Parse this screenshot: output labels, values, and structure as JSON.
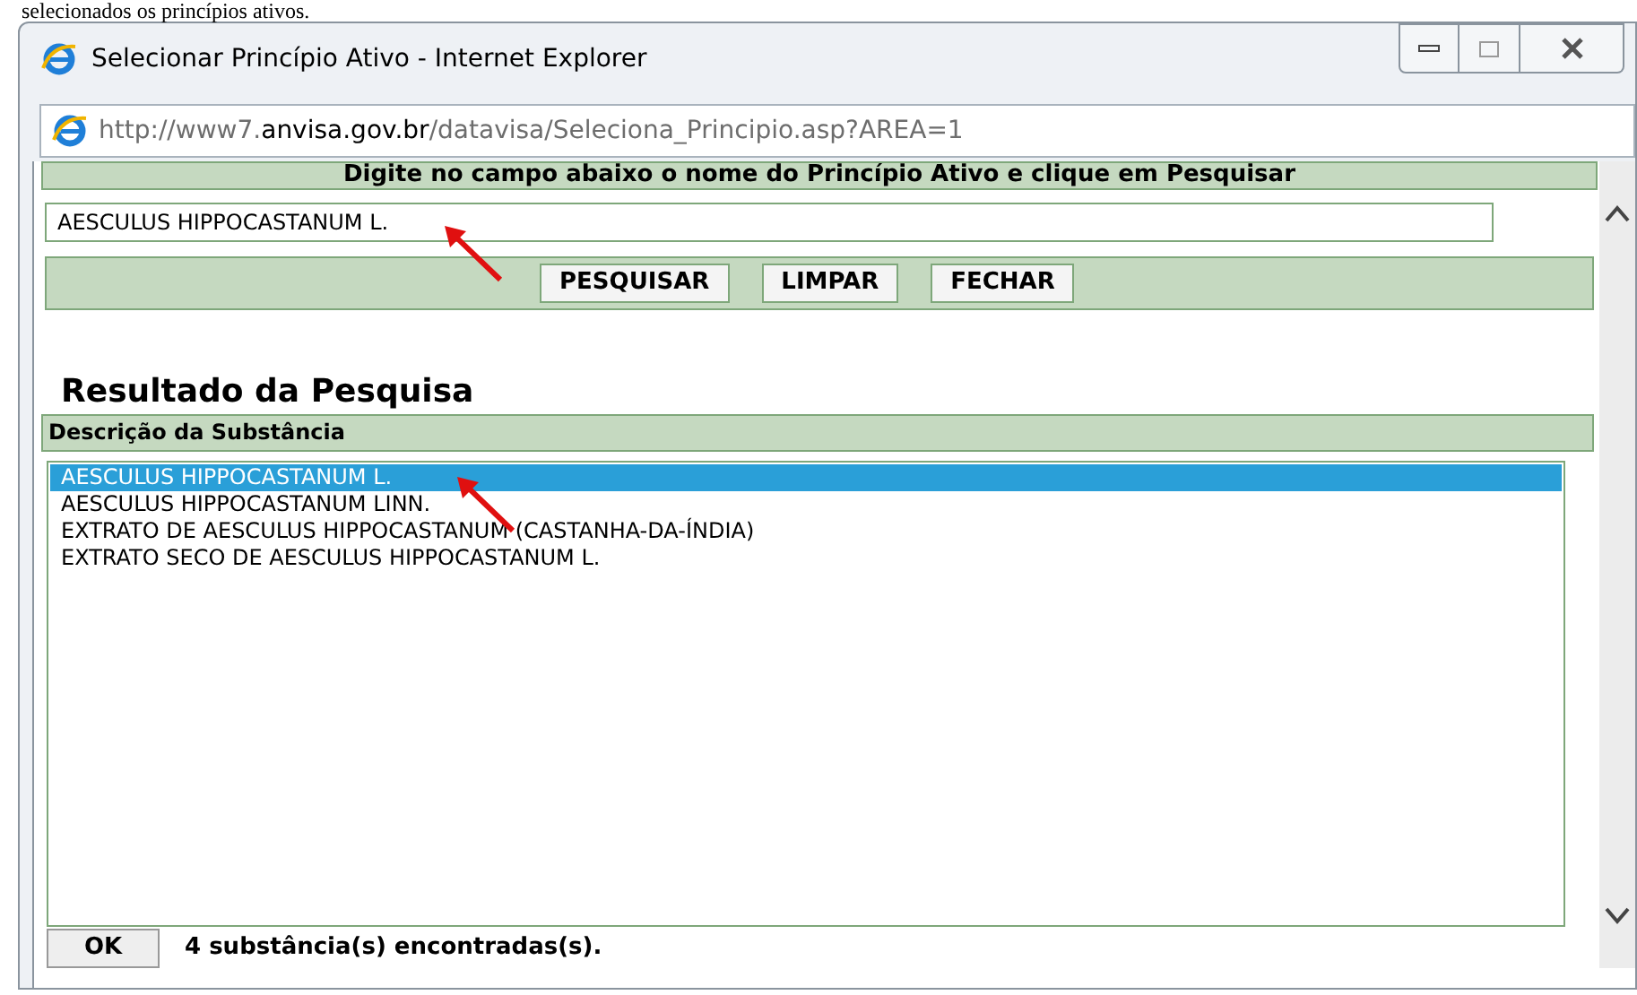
{
  "document_text": "selecionados os princípios ativos.",
  "window": {
    "title": "Selecionar Princípio Ativo - Internet Explorer"
  },
  "address_bar": {
    "prefix": "http://www7.",
    "domain": "anvisa.gov.br",
    "path": "/datavisa/Seleciona_Principio.asp?AREA=1"
  },
  "page": {
    "instruction": "Digite no campo abaixo o nome do Princípio Ativo e clique em Pesquisar",
    "search": {
      "value": "AESCULUS HIPPOCASTANUM L."
    },
    "buttons": [
      "PESQUISAR",
      "LIMPAR",
      "FECHAR"
    ],
    "results_heading": "Resultado da Pesquisa",
    "column_header": "Descrição da Substância",
    "results": [
      {
        "label": "AESCULUS HIPPOCASTANUM L.",
        "selected": true
      },
      {
        "label": "AESCULUS HIPPOCASTANUM LINN.",
        "selected": false
      },
      {
        "label": "EXTRATO DE AESCULUS HIPPOCASTANUM (CASTANHA-DA-ÍNDIA)",
        "selected": false
      },
      {
        "label": "EXTRATO SECO DE AESCULUS HIPPOCASTANUM L.",
        "selected": false
      }
    ],
    "ok_button": "OK",
    "status": "4 substância(s) encontradas(s)."
  }
}
